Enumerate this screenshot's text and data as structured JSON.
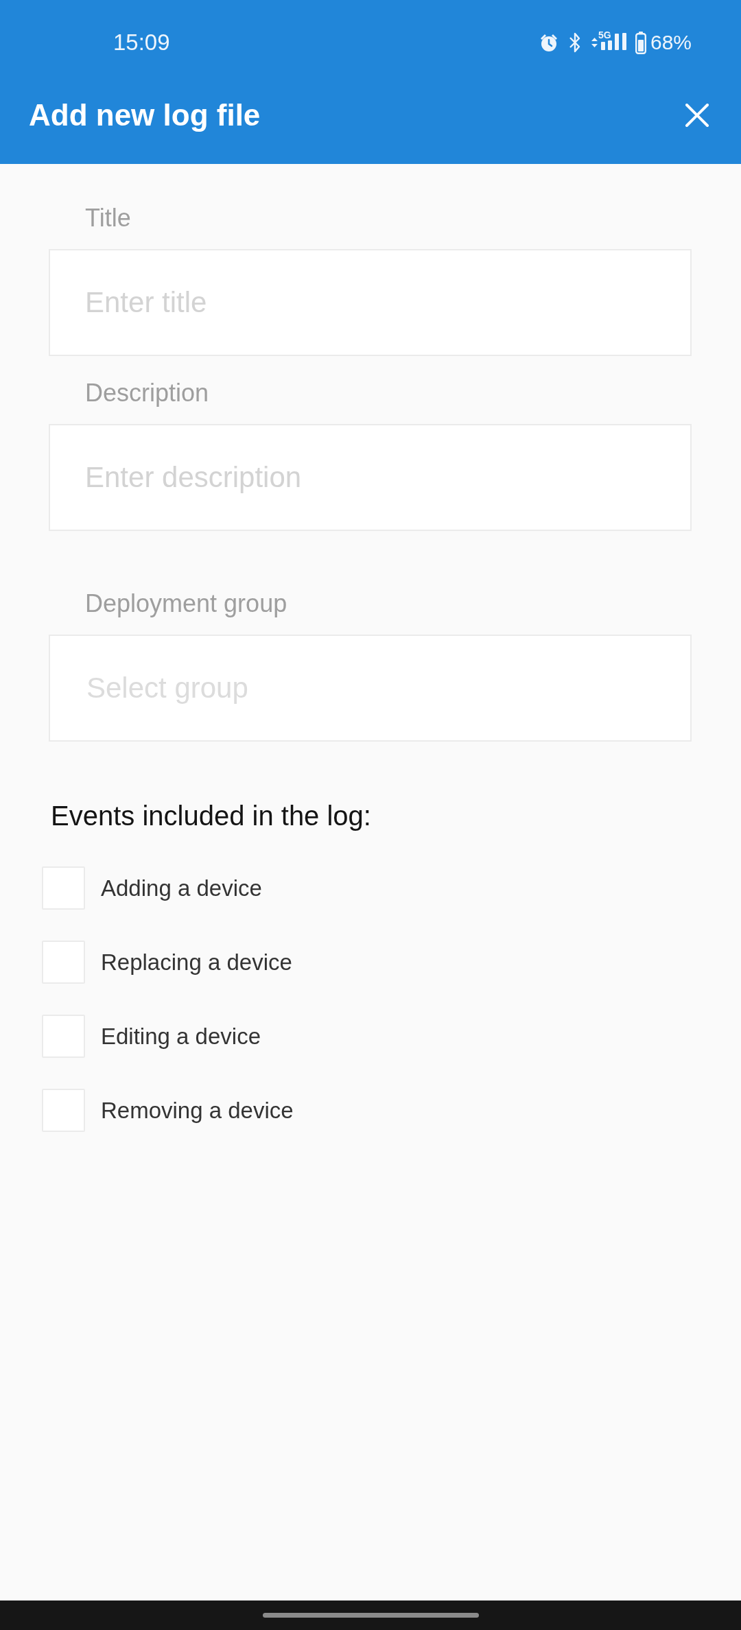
{
  "status_bar": {
    "time": "15:09",
    "network": "5G",
    "battery": "68%"
  },
  "app_bar": {
    "title": "Add new log file"
  },
  "form": {
    "fields": [
      {
        "kind": "text",
        "label": "Title",
        "placeholder": "Enter title"
      },
      {
        "kind": "text",
        "label": "Description",
        "placeholder": "Enter description"
      },
      {
        "kind": "select",
        "label": "Deployment group",
        "placeholder": "Select group"
      }
    ]
  },
  "events": {
    "heading": "Events included in the log:",
    "options": [
      {
        "label": "Adding a device",
        "checked": false
      },
      {
        "label": "Replacing a device",
        "checked": false
      },
      {
        "label": "Editing a device",
        "checked": false
      },
      {
        "label": "Removing a device",
        "checked": false
      }
    ]
  }
}
